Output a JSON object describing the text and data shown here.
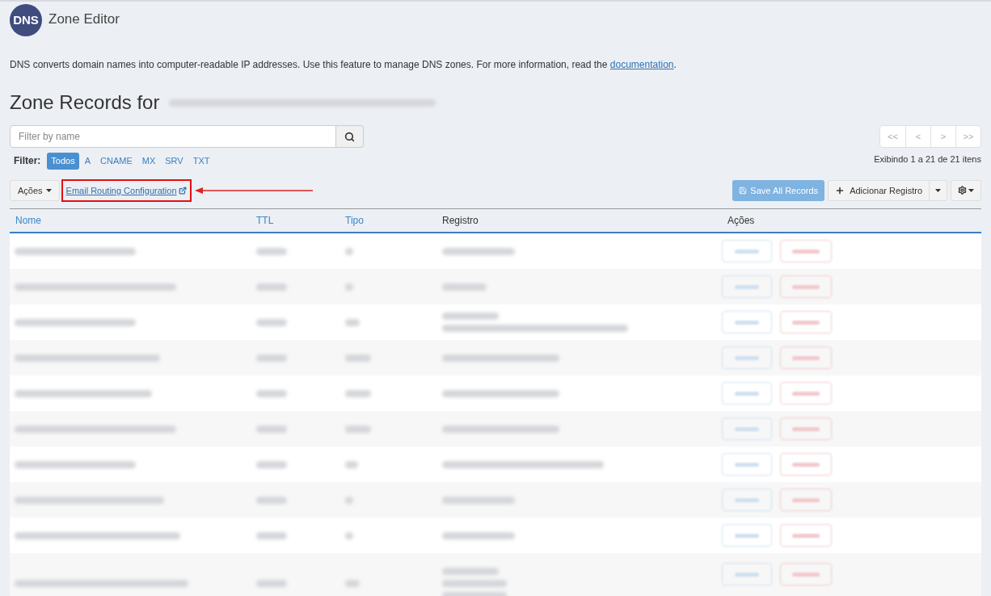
{
  "header": {
    "logo_text": "DNS",
    "title": "Zone Editor"
  },
  "description": {
    "text": "DNS converts domain names into computer-readable IP addresses. Use this feature to manage DNS zones. For more information, read the ",
    "link": "documentation",
    "end": "."
  },
  "heading": {
    "text": "Zone Records for"
  },
  "search": {
    "placeholder": "Filter by name"
  },
  "pagination": {
    "buttons": [
      "<<",
      "<",
      ">",
      ">>"
    ],
    "summary": "Exibindo 1 a 21 de 21 itens"
  },
  "filter": {
    "label": "Filter:",
    "options": [
      {
        "label": "Todos",
        "selected": true
      },
      {
        "label": "A",
        "selected": false
      },
      {
        "label": "CNAME",
        "selected": false
      },
      {
        "label": "MX",
        "selected": false
      },
      {
        "label": "SRV",
        "selected": false
      },
      {
        "label": "TXT",
        "selected": false
      }
    ]
  },
  "toolbar": {
    "actions_menu": "Ações",
    "routing_link": "Email Routing Configuration",
    "highlighted": true,
    "save": {
      "label": "Save All Records",
      "disabled": true
    },
    "add": "Adicionar Registro"
  },
  "table": {
    "columns": [
      {
        "label": "Nome",
        "sortable": true
      },
      {
        "label": "TTL",
        "sortable": true
      },
      {
        "label": "Tipo",
        "sortable": true
      },
      {
        "label": "Registro",
        "sortable": false
      },
      {
        "label": "Ações",
        "sortable": false
      }
    ],
    "rows": [
      {
        "kind": "single"
      },
      {
        "kind": "single"
      },
      {
        "kind": "double"
      },
      {
        "kind": "single"
      },
      {
        "kind": "single"
      },
      {
        "kind": "single"
      },
      {
        "kind": "single"
      },
      {
        "kind": "single"
      },
      {
        "kind": "single"
      },
      {
        "kind": "triple"
      }
    ]
  }
}
